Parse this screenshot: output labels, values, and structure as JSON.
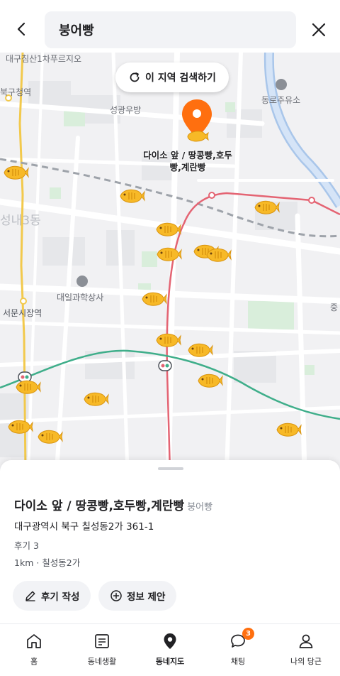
{
  "search": {
    "value": "붕어빵"
  },
  "map": {
    "research_label": "이 지역 검색하기",
    "labels": {
      "top_left": "대구침산1차푸르지오",
      "buk_office": "북구청역",
      "seonggwang": "성광우방",
      "gas_station": "동로주유소",
      "district": "성내3동",
      "market": "대일과학상사",
      "station": "서문시장역",
      "edge": "중"
    },
    "selected_pin_title": "다이소 앞 / 땅콩빵,호두빵,계란빵",
    "colors": {
      "accent": "#ff6f0f",
      "fish": "#f7b927",
      "rail": "#e46473",
      "subway_green": "#3fae8a"
    }
  },
  "store": {
    "name": "다이소 앞 / 땅콩빵,호두빵,계란빵",
    "category": "붕어빵",
    "address": "대구광역시 북구 칠성동2가 361-1",
    "reviews": "후기 3",
    "distance": "1km · 칠성동2가",
    "write_review": "후기 작성",
    "suggest_info": "정보 제안"
  },
  "nav": {
    "items": [
      {
        "label": "홈",
        "icon": "home-icon"
      },
      {
        "label": "동네생활",
        "icon": "community-icon"
      },
      {
        "label": "동네지도",
        "icon": "map-pin-icon"
      },
      {
        "label": "채팅",
        "icon": "chat-icon"
      },
      {
        "label": "나의 당근",
        "icon": "profile-icon"
      }
    ],
    "chat_badge": "3"
  }
}
